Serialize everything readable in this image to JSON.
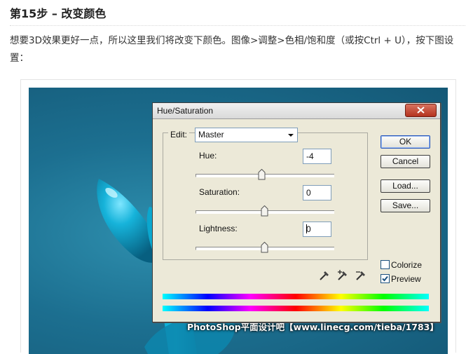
{
  "article": {
    "title": "第15步 – 改变颜色",
    "paragraph": "想要3D效果更好一点，所以这里我们将改变下颜色。图像>调整>色相/饱和度（或按Ctrl + U），按下图设置："
  },
  "watermark": "PhotoShop平面设计吧【www.linecg.com/tieba/1783】",
  "dialog": {
    "title": "Hue/Saturation",
    "edit_label": "Edit:",
    "edit_value": "Master",
    "hue": {
      "label": "Hue:",
      "value": "-4",
      "slider": -4
    },
    "saturation": {
      "label": "Saturation:",
      "value": "0",
      "slider": 0
    },
    "lightness": {
      "label": "Lightness:",
      "value": "0",
      "slider": 0
    },
    "buttons": {
      "ok": "OK",
      "cancel": "Cancel",
      "load": "Load...",
      "save": "Save..."
    },
    "colorize": {
      "label": "Colorize",
      "checked": false
    },
    "preview": {
      "label": "Preview",
      "checked": true
    }
  },
  "icons": [
    "close-icon",
    "eyedropper-icon",
    "eyedropper-plus-icon",
    "eyedropper-minus-icon",
    "dropdown-arrow-icon",
    "slider-thumb-icon"
  ],
  "colors": {
    "canvas": "#1c6f90",
    "dialog": "#ece9d8",
    "close_button": "#c0432c",
    "ok_border": "#2857b8"
  }
}
